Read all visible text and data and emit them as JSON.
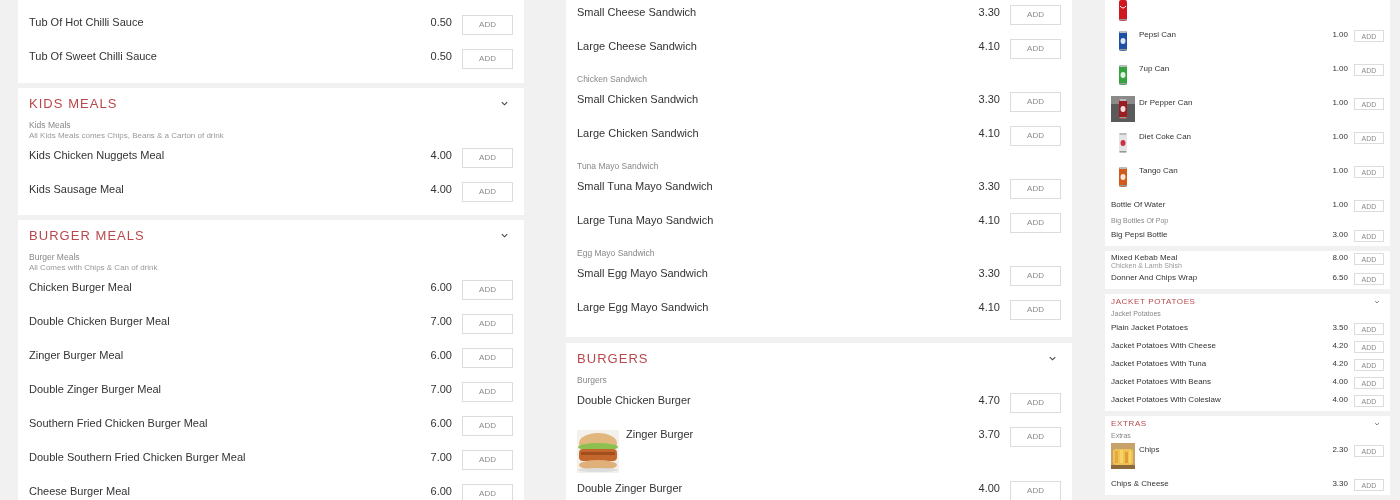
{
  "columns": [
    {
      "kind": "regular",
      "cards": [
        {
          "groups": [
            {
              "items": [
                {
                  "name": "Tub Of Hot Chilli Sauce",
                  "price": "0.50",
                  "button": "ADD"
                },
                {
                  "name": "Tub Of Sweet Chilli Sauce",
                  "price": "0.50",
                  "button": "ADD"
                }
              ]
            }
          ]
        },
        {
          "title": "KIDS MEALS",
          "expanded": true,
          "groups": [
            {
              "label": "Kids Meals",
              "note": "All Kids Meals comes Chips, Beans & a Carton of drink",
              "items": [
                {
                  "name": "Kids Chicken Nuggets Meal",
                  "price": "4.00",
                  "button": "ADD"
                },
                {
                  "name": "Kids Sausage Meal",
                  "price": "4.00",
                  "button": "ADD"
                }
              ]
            }
          ]
        },
        {
          "title": "BURGER MEALS",
          "expanded": true,
          "groups": [
            {
              "label": "Burger Meals",
              "note": "All Comes with Chips & Can of drink",
              "items": [
                {
                  "name": "Chicken Burger Meal",
                  "price": "6.00",
                  "button": "ADD"
                },
                {
                  "name": "Double Chicken Burger Meal",
                  "price": "7.00",
                  "button": "ADD"
                },
                {
                  "name": "Zinger Burger Meal",
                  "price": "6.00",
                  "button": "ADD"
                },
                {
                  "name": "Double Zinger Burger Meal",
                  "price": "7.00",
                  "button": "ADD"
                },
                {
                  "name": "Southern Fried Chicken Burger Meal",
                  "price": "6.00",
                  "button": "ADD"
                },
                {
                  "name": "Double Southern Fried Chicken Burger Meal",
                  "price": "7.00",
                  "button": "ADD"
                },
                {
                  "name": "Cheese Burger Meal",
                  "price": "6.00",
                  "button": "ADD"
                }
              ]
            }
          ]
        }
      ]
    },
    {
      "kind": "regular",
      "cards": [
        {
          "groups": [
            {
              "items": [
                {
                  "name": "Small Cheese Sandwich",
                  "price": "3.30",
                  "button": "ADD"
                },
                {
                  "name": "Large Cheese Sandwich",
                  "price": "4.10",
                  "button": "ADD"
                }
              ]
            },
            {
              "label": "Chicken Sandwich",
              "items": [
                {
                  "name": "Small Chicken Sandwich",
                  "price": "3.30",
                  "button": "ADD"
                },
                {
                  "name": "Large Chicken Sandwich",
                  "price": "4.10",
                  "button": "ADD"
                }
              ]
            },
            {
              "label": "Tuna Mayo Sandwich",
              "items": [
                {
                  "name": "Small Tuna Mayo Sandwich",
                  "price": "3.30",
                  "button": "ADD"
                },
                {
                  "name": "Large Tuna Mayo Sandwich",
                  "price": "4.10",
                  "button": "ADD"
                }
              ]
            },
            {
              "label": "Egg Mayo Sandwich",
              "items": [
                {
                  "name": "Small Egg Mayo Sandwich",
                  "price": "3.30",
                  "button": "ADD"
                },
                {
                  "name": "Large Egg Mayo Sandwich",
                  "price": "4.10",
                  "button": "ADD"
                }
              ]
            }
          ]
        },
        {
          "title": "BURGERS",
          "expanded": true,
          "groups": [
            {
              "label": "Burgers",
              "items": [
                {
                  "name": "Double Chicken Burger",
                  "price": "4.70",
                  "button": "ADD"
                },
                {
                  "name": "Zinger Burger",
                  "price": "3.70",
                  "button": "ADD",
                  "kind": "picture"
                },
                {
                  "name": "Double Zinger Burger",
                  "price": "4.00",
                  "button": "ADD"
                }
              ]
            }
          ]
        }
      ]
    },
    {
      "kind": "compact",
      "cards": [
        {
          "groups": [
            {
              "items": [
                {
                  "name": "Pepsi Can",
                  "price": "1.00",
                  "button": "ADD",
                  "kind": "picture"
                },
                {
                  "name": "7up Can",
                  "price": "1.00",
                  "button": "ADD",
                  "kind": "picture"
                },
                {
                  "name": "Dr Pepper Can",
                  "price": "1.00",
                  "button": "ADD",
                  "kind": "picture"
                },
                {
                  "name": "Diet Coke Can",
                  "price": "1.00",
                  "button": "ADD",
                  "kind": "picture"
                },
                {
                  "name": "Tango Can",
                  "price": "1.00",
                  "button": "ADD",
                  "kind": "picture"
                },
                {
                  "name": "Bottle Of Water",
                  "price": "1.00",
                  "button": "ADD"
                }
              ]
            },
            {
              "label": "Big Bottles Of Pop",
              "items": [
                {
                  "name": "Big Pepsi Bottle",
                  "price": "3.00",
                  "button": "ADD"
                }
              ]
            }
          ]
        },
        {
          "groups": [
            {
              "items": [
                {
                  "name": "Mixed Kebab Meal",
                  "note": "Chicken & Lamb Shish",
                  "price": "8.00",
                  "button": "ADD"
                },
                {
                  "name": "Donner And Chips Wrap",
                  "price": "6.50",
                  "button": "ADD"
                }
              ]
            }
          ]
        },
        {
          "title": "JACKET POTATOES",
          "expanded": true,
          "groups": [
            {
              "label": "Jacket Potatoes",
              "items": [
                {
                  "name": "Plain Jacket Potatoes",
                  "price": "3.50",
                  "button": "ADD"
                },
                {
                  "name": "Jacket Potatoes With Cheese",
                  "price": "4.20",
                  "button": "ADD"
                },
                {
                  "name": "Jacket Potatoes With Tuna",
                  "price": "4.20",
                  "button": "ADD"
                },
                {
                  "name": "Jacket Potatoes With Beans",
                  "price": "4.00",
                  "button": "ADD"
                },
                {
                  "name": "Jacket Potatoes With Coleslaw",
                  "price": "4.00",
                  "button": "ADD"
                }
              ]
            }
          ]
        },
        {
          "title": "EXTRAS",
          "expanded": true,
          "groups": [
            {
              "label": "Extras",
              "items": [
                {
                  "name": "Chips",
                  "price": "2.30",
                  "button": "ADD",
                  "kind": "picture"
                },
                {
                  "name": "Chips & Cheese",
                  "price": "3.30",
                  "button": "ADD"
                }
              ]
            }
          ]
        }
      ]
    }
  ]
}
